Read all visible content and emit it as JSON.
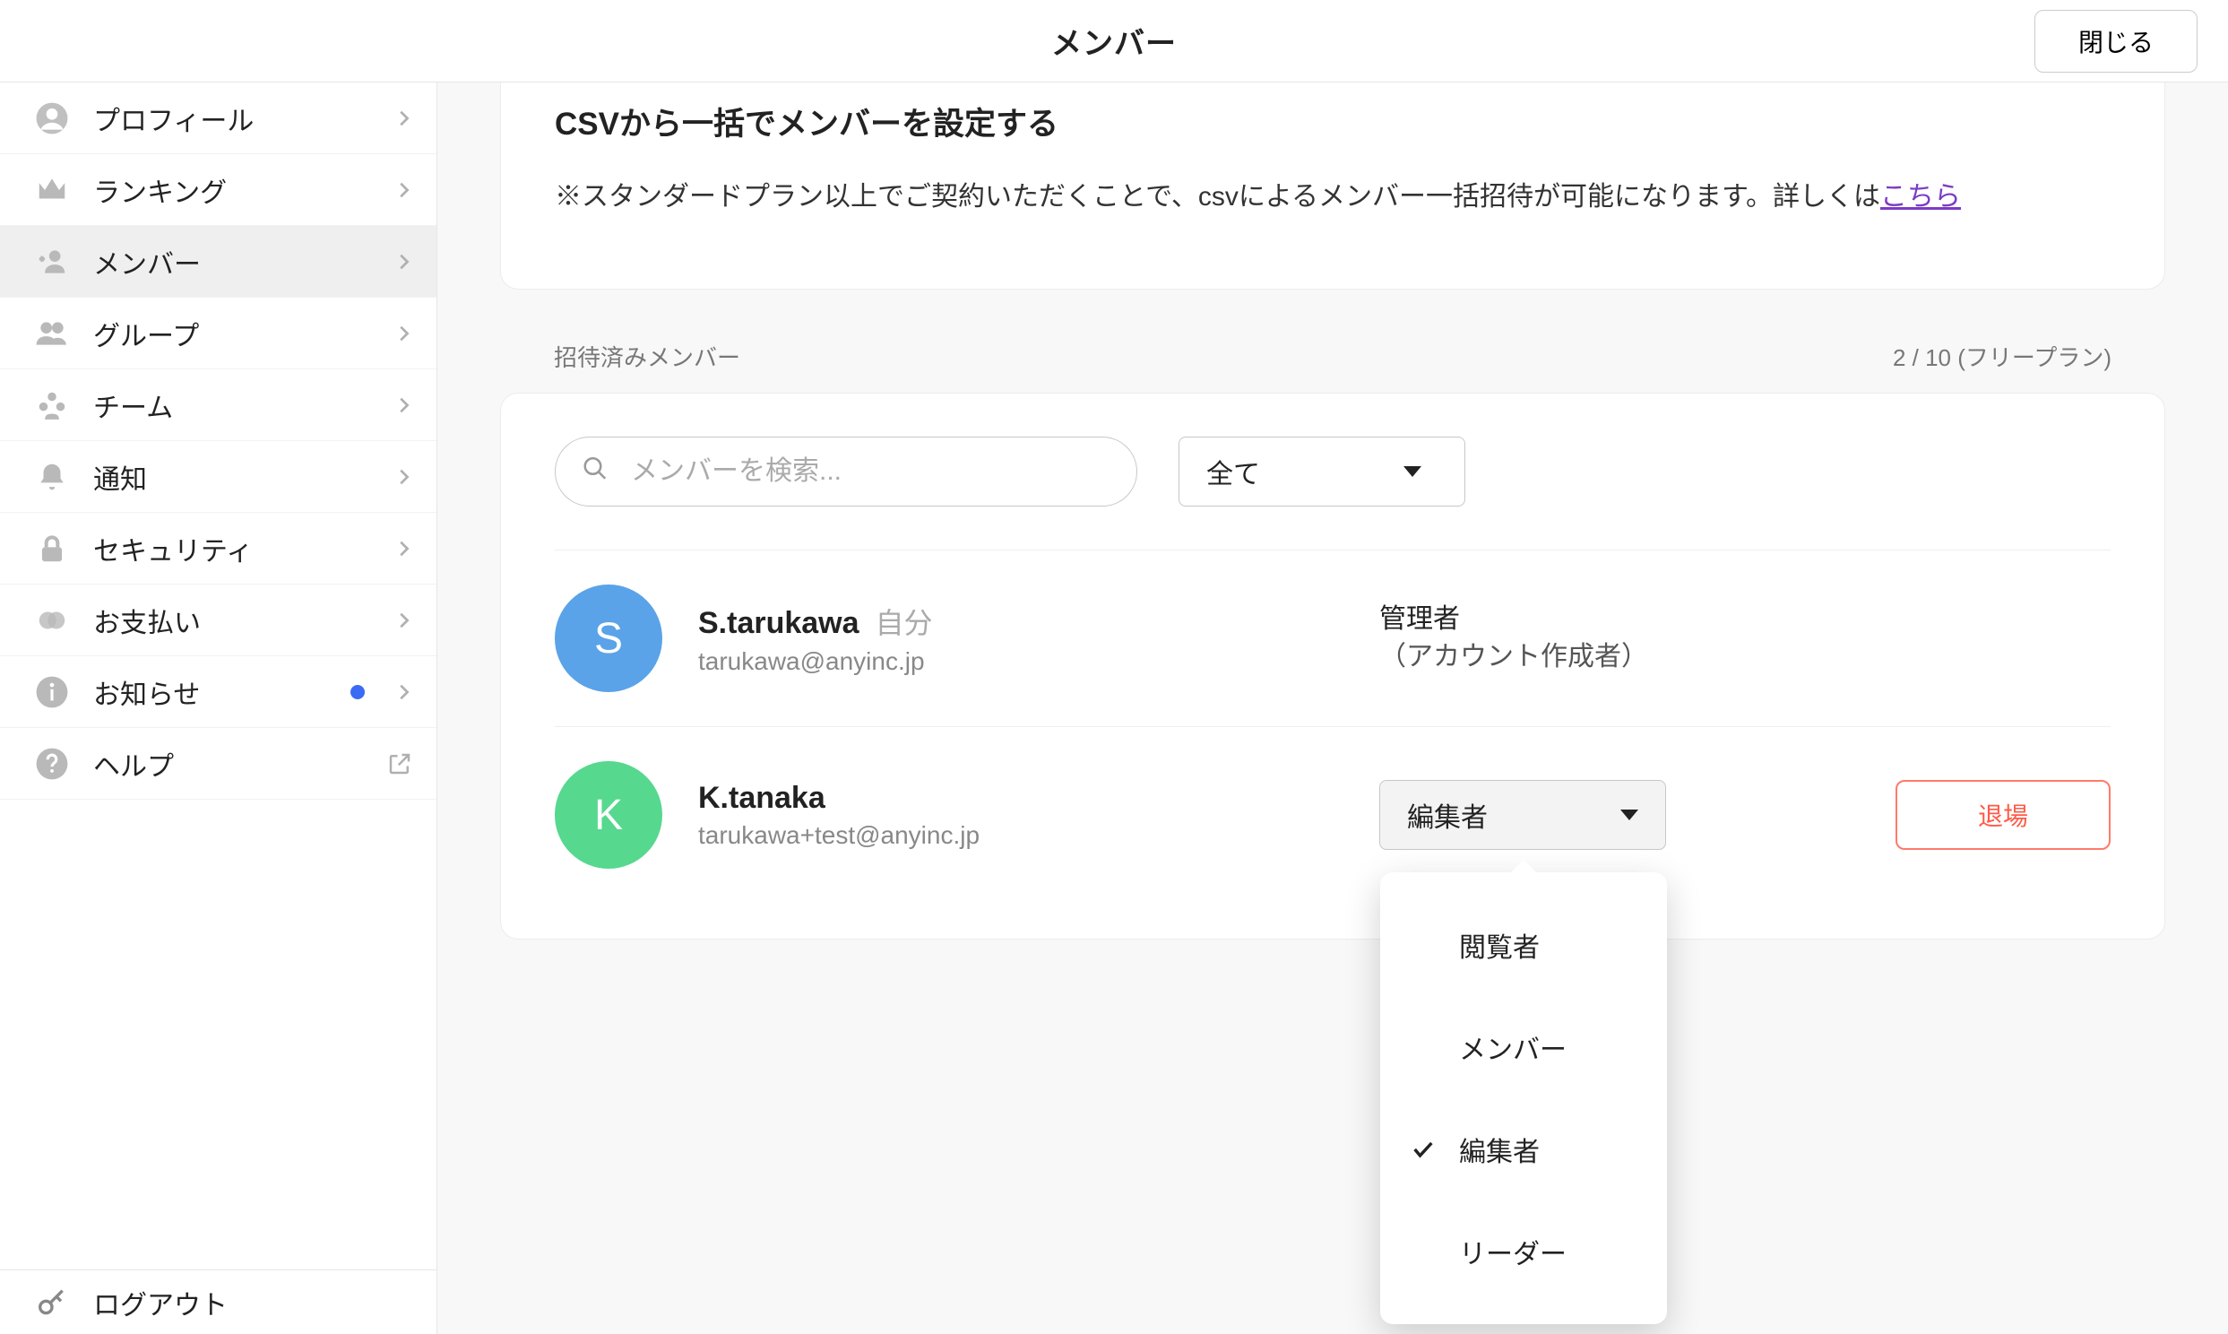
{
  "header": {
    "title": "メンバー",
    "close_label": "閉じる"
  },
  "sidebar": {
    "items": [
      {
        "key": "profile",
        "label": "プロフィール",
        "icon": "user-circle",
        "trailing": "chevron"
      },
      {
        "key": "ranking",
        "label": "ランキング",
        "icon": "crown",
        "trailing": "chevron"
      },
      {
        "key": "members",
        "label": "メンバー",
        "icon": "add-user",
        "trailing": "chevron",
        "active": true
      },
      {
        "key": "groups",
        "label": "グループ",
        "icon": "users",
        "trailing": "chevron"
      },
      {
        "key": "teams",
        "label": "チーム",
        "icon": "team",
        "trailing": "chevron"
      },
      {
        "key": "notify",
        "label": "通知",
        "icon": "bell",
        "trailing": "chevron"
      },
      {
        "key": "security",
        "label": "セキュリティ",
        "icon": "lock",
        "trailing": "chevron"
      },
      {
        "key": "billing",
        "label": "お支払い",
        "icon": "credit",
        "trailing": "chevron"
      },
      {
        "key": "news",
        "label": "お知らせ",
        "icon": "info",
        "trailing": "chevron",
        "dot": true
      },
      {
        "key": "help",
        "label": "ヘルプ",
        "icon": "question",
        "trailing": "external"
      }
    ],
    "logout_label": "ログアウト"
  },
  "csv": {
    "title": "CSVから一括でメンバーを設定する",
    "desc_prefix": "※スタンダードプラン以上でご契約いただくことで、csvによるメンバー一括招待が可能になります。詳しくは",
    "desc_link": "こちら"
  },
  "section": {
    "left": "招待済みメンバー",
    "right": "2 / 10 (フリープラン)"
  },
  "filters": {
    "search_placeholder": "メンバーを検索...",
    "filter_selected": "全て"
  },
  "members": [
    {
      "initial": "S",
      "avatar_color": "#5aa3e8",
      "name": "S.tarukawa",
      "self_tag": "自分",
      "email": "tarukawa@anyinc.jp",
      "role_display": "管理者",
      "role_sub": "（アカウント作成者）",
      "role_editable": false
    },
    {
      "initial": "K",
      "avatar_color": "#56d88f",
      "name": "K.tanaka",
      "self_tag": "",
      "email": "tarukawa+test@anyinc.jp",
      "role_display": "編集者",
      "role_sub": "",
      "role_editable": true,
      "leave_label": "退場"
    }
  ],
  "role_dropdown": {
    "options": [
      "閲覧者",
      "メンバー",
      "編集者",
      "リーダー"
    ],
    "selected_index": 2
  }
}
